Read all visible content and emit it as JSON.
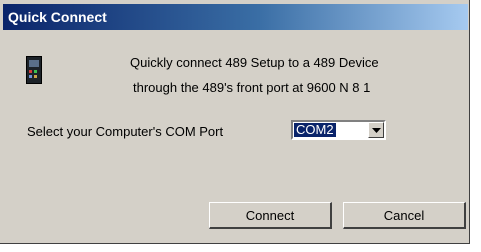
{
  "window": {
    "title": "Quick Connect",
    "icon": "device-icon"
  },
  "message": {
    "line1": "Quickly connect 489 Setup to a 489 Device",
    "line2": "through the 489's front port at 9600 N 8 1"
  },
  "com_port": {
    "label": "Select your Computer's COM Port",
    "selected": "COM2",
    "dropdown_icon": "chevron-down-icon"
  },
  "buttons": {
    "connect": "Connect",
    "cancel": "Cancel"
  },
  "colors": {
    "titlebar_start": "#0a246a",
    "titlebar_end": "#a6caf0",
    "dialog_bg": "#d4d0c8",
    "selection": "#0a246a"
  }
}
